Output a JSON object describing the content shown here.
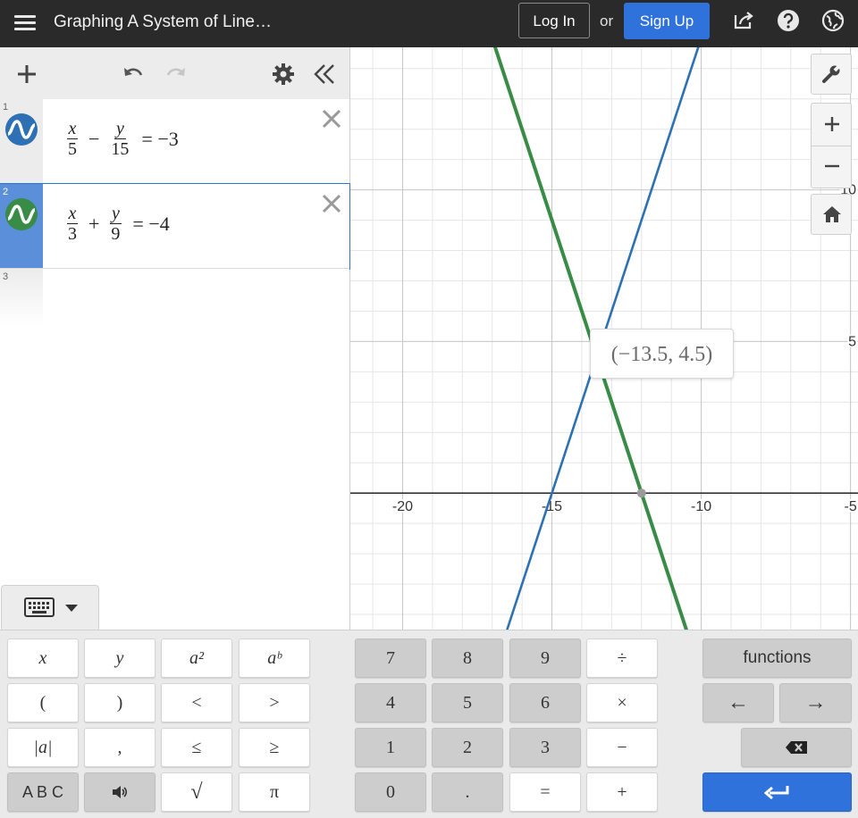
{
  "header": {
    "title": "Graphing A System of Line…",
    "login_label": "Log In",
    "or_label": "or",
    "signup_label": "Sign Up",
    "icons": [
      "menu-icon",
      "share-icon",
      "help-icon",
      "globe-icon"
    ]
  },
  "toolbar": {
    "icons": [
      "add-icon",
      "undo-icon",
      "redo-icon",
      "settings-gear-icon",
      "collapse-panel-icon"
    ]
  },
  "expressions": [
    {
      "index": "1",
      "color": "#2d70b3",
      "lhs1": {
        "num": "x",
        "den": "5"
      },
      "op": "−",
      "lhs2": {
        "num": "y",
        "den": "15"
      },
      "rhs": "= −3"
    },
    {
      "index": "2",
      "color": "#388c46",
      "lhs1": {
        "num": "x",
        "den": "3"
      },
      "op": "+",
      "lhs2": {
        "num": "y",
        "den": "9"
      },
      "rhs": "= −4"
    },
    {
      "index": "3"
    }
  ],
  "graph": {
    "x_ticks": [
      "-20",
      "-15",
      "-10",
      "-5"
    ],
    "y_ticks": [
      "5",
      "10"
    ],
    "intersection_label": "(−13.5, 4.5)",
    "controls": [
      "wrench-icon",
      "zoom-in-icon",
      "zoom-out-icon",
      "home-icon"
    ]
  },
  "keypad": {
    "toggle_icon": "keyboard-icon",
    "left_keys": [
      "x",
      "y",
      "a²",
      "aᵇ",
      "(",
      ")",
      "<",
      ">",
      "|a|",
      ",",
      "≤",
      "≥",
      "A B C",
      "speaker",
      "√",
      "π"
    ],
    "num_keys": [
      "7",
      "8",
      "9",
      "÷",
      "4",
      "5",
      "6",
      "×",
      "1",
      "2",
      "3",
      "−",
      "0",
      ".",
      "=",
      "+"
    ],
    "functions_label": "functions",
    "arrow_left": "←",
    "arrow_right": "→"
  },
  "colors": {
    "accent": "#2f72dc",
    "series_blue": "#2d70b3",
    "series_green": "#388c46",
    "topbar": "#2a2a2a"
  },
  "chart_data": {
    "type": "line",
    "xlim": [
      -21.75,
      -4.75
    ],
    "ylim": [
      -4.5,
      14.7
    ],
    "grid": true,
    "series": [
      {
        "name": "",
        "equation": "x/5 − y/15 = −3",
        "x": [
          -16.5,
          -9.5
        ],
        "y": [
          -4.5,
          16.5
        ]
      },
      {
        "name": "",
        "equation": "x/3 + y/9 = −4",
        "x": [
          -17.0,
          -10.5
        ],
        "y": [
          15.0,
          -4.5
        ]
      }
    ],
    "points": [
      {
        "x": -13.5,
        "y": 4.5,
        "label": "(−13.5, 4.5)"
      },
      {
        "x": -12.0,
        "y": 0
      }
    ]
  }
}
